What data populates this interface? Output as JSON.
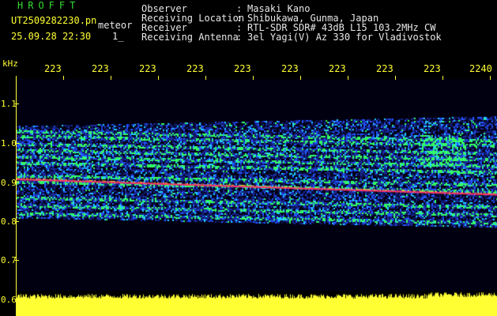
{
  "header": {
    "brand": "HROFFT",
    "filename": "UT2509282230.pn",
    "meteor_label": "meteor",
    "datetime": "25.09.28 22:30",
    "index": "1_",
    "fields": [
      {
        "label": "Observer",
        "sep": ":",
        "value": "Masaki Kano"
      },
      {
        "label": "Receiving Location",
        "sep": ":",
        "value": "Shibukawa, Gunma, Japan"
      },
      {
        "label": "Receiver",
        "sep": ":",
        "value": "RTL-SDR SDR# 43dB L15 103.2MHz CW"
      },
      {
        "label": "Receiving Antenna",
        "sep": ":",
        "value": "3el Yagi(V) Az 330 for Vladivostok"
      }
    ]
  },
  "axes": {
    "y_unit": "kHz",
    "y_ticks": [
      "1.1",
      "1.0",
      "0.9",
      "0.8",
      "0.7",
      "0.6"
    ],
    "x_ticks": [
      "223",
      "223",
      "223",
      "223",
      "223",
      "223",
      "223",
      "223",
      "223",
      "2240"
    ]
  },
  "colors": {
    "background": "#000000",
    "axis": "#ffff33",
    "label": "#e8e8e8",
    "brand": "#33dd33",
    "signal_strong": "#ff3366",
    "signal_mid": "#33ff66",
    "signal_low": "#2233cc"
  }
}
